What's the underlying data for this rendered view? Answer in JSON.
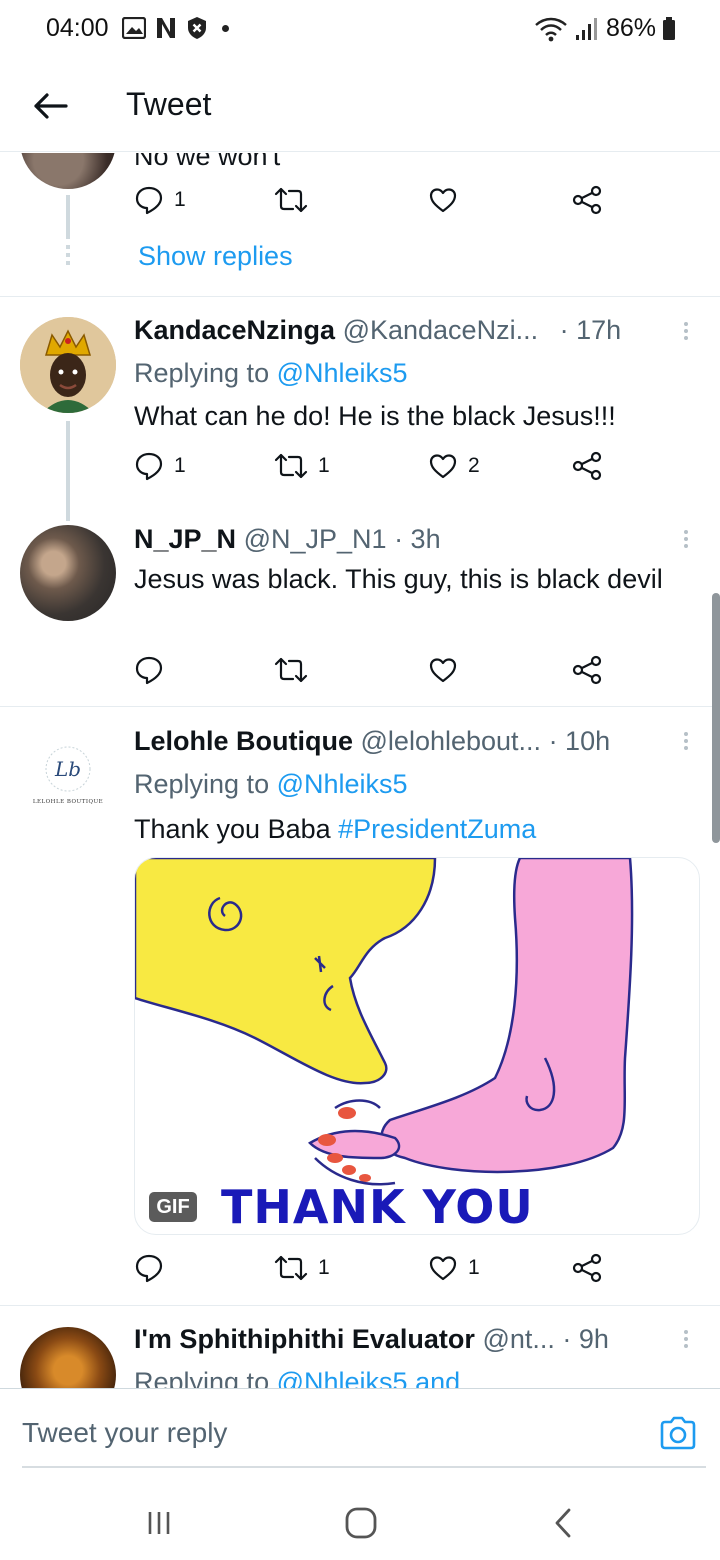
{
  "status_bar": {
    "time": "04:00",
    "battery": "86%"
  },
  "header": {
    "title": "Tweet"
  },
  "partial_tweet": {
    "text_fragment": "No we won't",
    "reply_count": "1",
    "show_replies": "Show replies"
  },
  "tweets": [
    {
      "name": "KandaceNzinga",
      "handle": "@KandaceNzi...",
      "time": "· 17h",
      "replying_label": "Replying to",
      "replying_to": "@Nhleiks5",
      "text": "What can he do! He is the black Jesus!!!",
      "replies": "1",
      "retweets": "1",
      "likes": "2"
    },
    {
      "name": "N_JP_N",
      "handle": "@N_JP_N1",
      "time": "· 3h",
      "text": "Jesus was black. This guy, this is black devil",
      "replies": "",
      "retweets": "",
      "likes": ""
    },
    {
      "name": "Lelohle Boutique",
      "handle": "@lelohlebout...",
      "time": "· 10h",
      "replying_label": "Replying to",
      "replying_to": "@Nhleiks5",
      "text_prefix": "Thank you Baba",
      "hashtag": "#PresidentZuma",
      "gif_badge": "GIF",
      "gif_caption": "THANK YOU",
      "avatar_monogram": "Lb",
      "avatar_wordmark": "LELOHLE BOUTIQUE",
      "replies": "",
      "retweets": "1",
      "likes": "1"
    },
    {
      "name": "I'm Sphithiphithi Evaluator",
      "handle": "@nt...",
      "time": "· 9h",
      "replying_label": "Replying to",
      "replying_to": "@Nhleiks5 and"
    }
  ],
  "reply_box": {
    "placeholder": "Tweet your reply"
  },
  "colors": {
    "link": "#1d9bf0",
    "muted": "#536471",
    "divider": "#e6ecf0"
  }
}
